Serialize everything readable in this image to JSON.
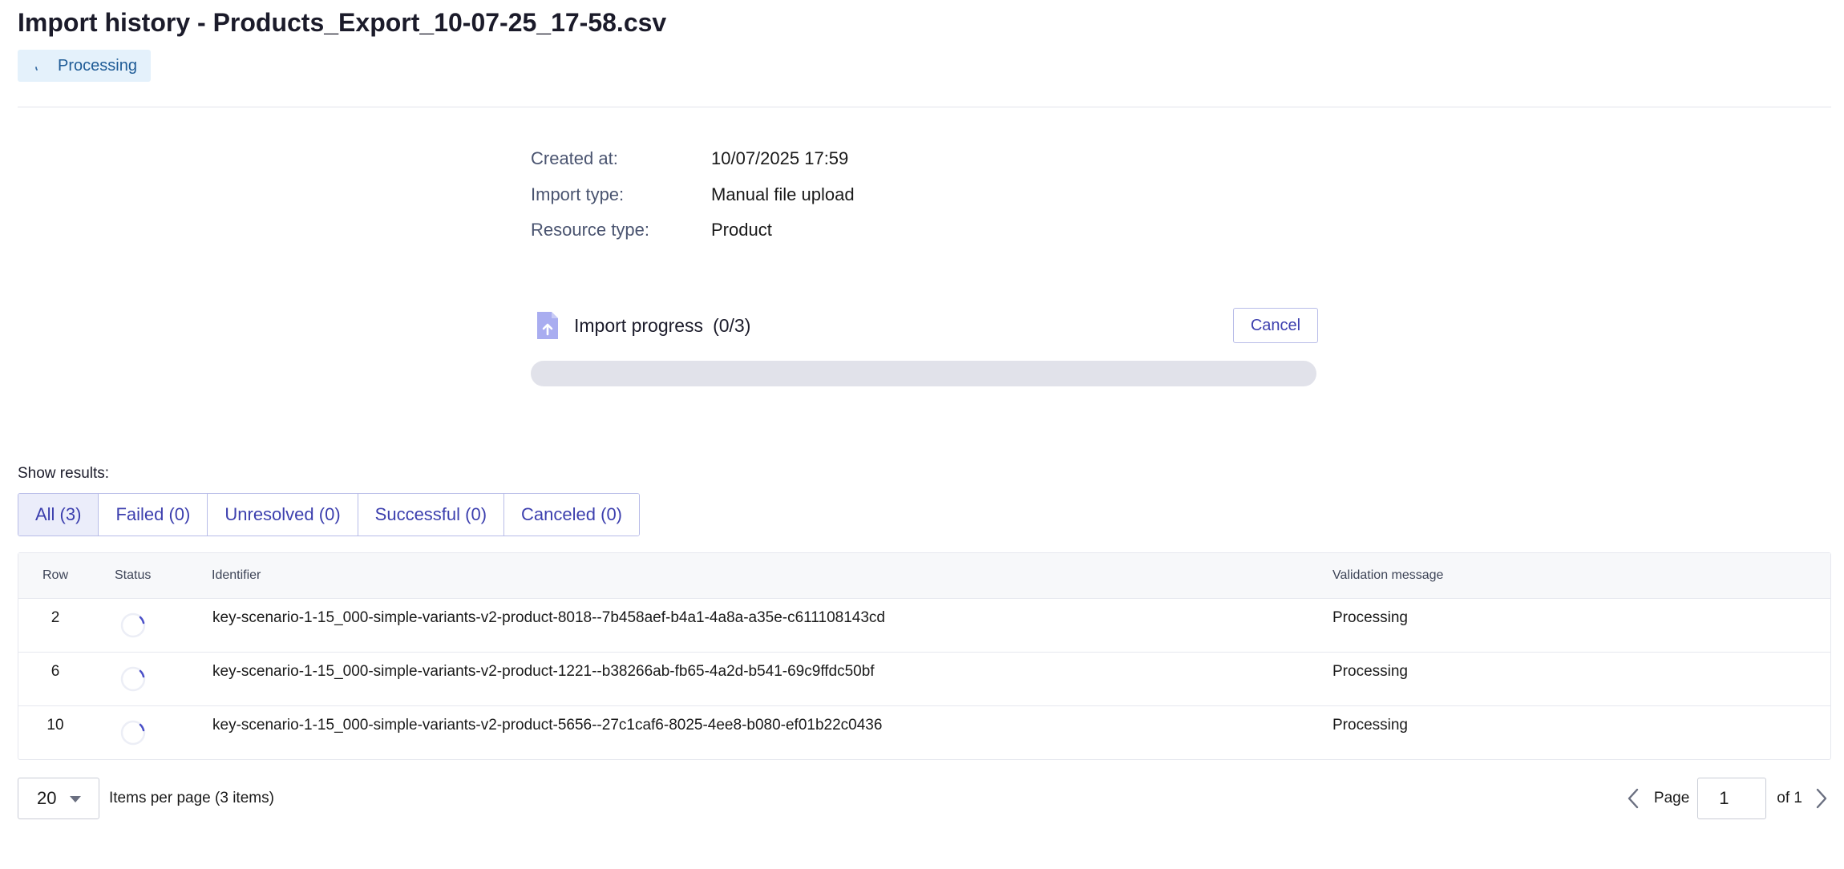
{
  "header": {
    "title": "Import history - Products_Export_10-07-25_17-58.csv",
    "status_label": "Processing"
  },
  "details": {
    "created_at_label": "Created at:",
    "created_at_value": "10/07/2025 17:59",
    "import_type_label": "Import type:",
    "import_type_value": "Manual file upload",
    "resource_type_label": "Resource type:",
    "resource_type_value": "Product"
  },
  "progress": {
    "title": "Import progress",
    "count": "(0/3)",
    "cancel_label": "Cancel",
    "fraction": 0
  },
  "filters": {
    "label": "Show results:",
    "items": [
      {
        "label": "All (3)",
        "active": true
      },
      {
        "label": "Failed (0)",
        "active": false
      },
      {
        "label": "Unresolved (0)",
        "active": false
      },
      {
        "label": "Successful (0)",
        "active": false
      },
      {
        "label": "Canceled (0)",
        "active": false
      }
    ]
  },
  "table": {
    "columns": {
      "row": "Row",
      "status": "Status",
      "identifier": "Identifier",
      "message": "Validation message"
    },
    "rows": [
      {
        "row": "2",
        "status_icon": "spinner-icon",
        "identifier": "key-scenario-1-15_000-simple-variants-v2-product-8018--7b458aef-b4a1-4a8a-a35e-c611108143cd",
        "message": "Processing"
      },
      {
        "row": "6",
        "status_icon": "spinner-icon",
        "identifier": "key-scenario-1-15_000-simple-variants-v2-product-1221--b38266ab-fb65-4a2d-b541-69c9ffdc50bf",
        "message": "Processing"
      },
      {
        "row": "10",
        "status_icon": "spinner-icon",
        "identifier": "key-scenario-1-15_000-simple-variants-v2-product-5656--27c1caf6-8025-4ee8-b080-ef01b22c0436",
        "message": "Processing"
      }
    ]
  },
  "pagination": {
    "per_page_value": "20",
    "per_page_label": "Items per page (3 items)",
    "page_label": "Page",
    "page_value": "1",
    "page_of": "of 1"
  },
  "colors": {
    "accent": "#3c3fae",
    "chip_bg": "#e4f1fb",
    "chip_text": "#1e5b96",
    "progress_track": "#e1e2ea"
  }
}
